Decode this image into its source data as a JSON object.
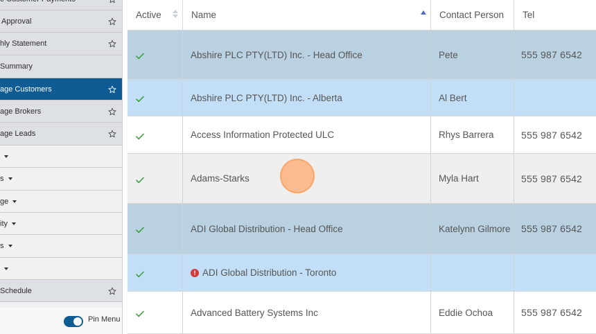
{
  "sidebar": {
    "items": [
      {
        "label": "e Customer Payments",
        "starred": true,
        "kind": "fav"
      },
      {
        "label": "Approval",
        "starred": true,
        "kind": "fav"
      },
      {
        "label": "hly Statement",
        "starred": true,
        "kind": "fav"
      },
      {
        "label": "Summary",
        "starred": false,
        "kind": "fav"
      },
      {
        "label": "age Customers",
        "starred": true,
        "kind": "active"
      },
      {
        "label": "age Brokers",
        "starred": true,
        "kind": "fav"
      },
      {
        "label": "age Leads",
        "starred": true,
        "kind": "fav"
      },
      {
        "label": "",
        "starred": false,
        "kind": "menu"
      },
      {
        "label": "s",
        "starred": false,
        "kind": "menu"
      },
      {
        "label": "ge",
        "starred": false,
        "kind": "menu"
      },
      {
        "label": "ity",
        "starred": false,
        "kind": "menu"
      },
      {
        "label": "s",
        "starred": false,
        "kind": "menu"
      },
      {
        "label": "",
        "starred": false,
        "kind": "menu"
      },
      {
        "label": "Schedule",
        "starred": true,
        "kind": "fav"
      }
    ],
    "pin_menu": {
      "label": "Pin Menu",
      "on": true
    }
  },
  "table": {
    "columns": [
      {
        "label": "Active",
        "sort": "both"
      },
      {
        "label": "Name",
        "sort": "asc"
      },
      {
        "label": "Contact Person",
        "sort": "none"
      },
      {
        "label": "Tel",
        "sort": "none"
      }
    ],
    "rows": [
      {
        "active": true,
        "name": "Abshire PLC PTY(LTD) Inc. - Head Office",
        "contact": "Pete",
        "tel": "555 987 6542",
        "style": "selected-dark",
        "alert": false
      },
      {
        "active": true,
        "name": "Abshire PLC PTY(LTD) Inc. - Alberta",
        "contact": "Al Bert",
        "tel": "",
        "style": "selected-light",
        "alert": false
      },
      {
        "active": true,
        "name": "Access Information Protected ULC",
        "contact": "Rhys Barrera",
        "tel": "555 987 6542",
        "style": "normal",
        "alert": false
      },
      {
        "active": true,
        "name": "Adams-Starks",
        "contact": "Myla Hart",
        "tel": "555 987 6542",
        "style": "hover",
        "alert": false
      },
      {
        "active": true,
        "name": "ADI Global Distribution - Head Office",
        "contact": "Katelynn Gilmore",
        "tel": "555 987 6542",
        "style": "selected-dark",
        "alert": false
      },
      {
        "active": true,
        "name": "ADI Global Distribution - Toronto",
        "contact": "",
        "tel": "",
        "style": "selected-light",
        "alert": true
      },
      {
        "active": true,
        "name": "Advanced Battery Systems Inc",
        "contact": "Eddie Ochoa",
        "tel": "555 987 6542",
        "style": "normal",
        "alert": false
      }
    ]
  },
  "colors": {
    "selected_dark": "#b9d1e0",
    "selected_light": "#c3dff8",
    "hover": "#efefef",
    "normal": "#ffffff",
    "active_nav": "#0f5c94",
    "check": "#3aa13a"
  },
  "icons": {
    "favorite": "star-outline-icon",
    "active": "checkmark-icon",
    "alert": "exclamation-circle-icon"
  },
  "alert_glyph": "!"
}
